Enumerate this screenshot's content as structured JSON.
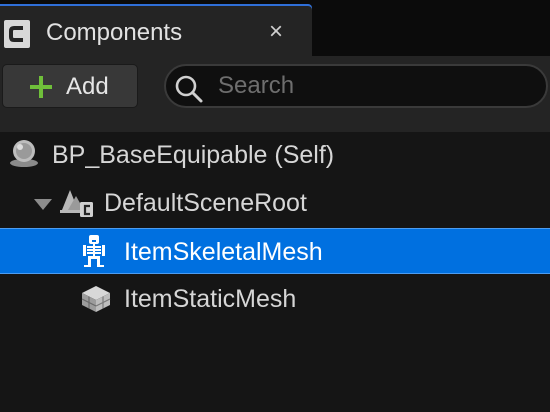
{
  "tab": {
    "title": "Components",
    "icon": "blueprint-component-icon",
    "close_glyph": "×"
  },
  "toolbar": {
    "add_label": "Add",
    "add_icon": "plus-icon",
    "search_placeholder": "Search",
    "search_value": ""
  },
  "tree": {
    "root": {
      "label": "BP_BaseEquipable (Self)",
      "icon": "blueprint-self-icon"
    },
    "scene_root": {
      "label": "DefaultSceneRoot",
      "icon": "scene-component-icon",
      "expanded": true
    },
    "items": [
      {
        "label": "ItemSkeletalMesh",
        "icon": "skeleton-icon",
        "selected": true
      },
      {
        "label": "ItemStaticMesh",
        "icon": "static-mesh-cube-icon",
        "selected": false
      }
    ]
  },
  "colors": {
    "accent": "#0070E0",
    "add_plus": "#6fbf3a",
    "panel_bg": "#151515",
    "toolbar_bg": "#242424"
  }
}
